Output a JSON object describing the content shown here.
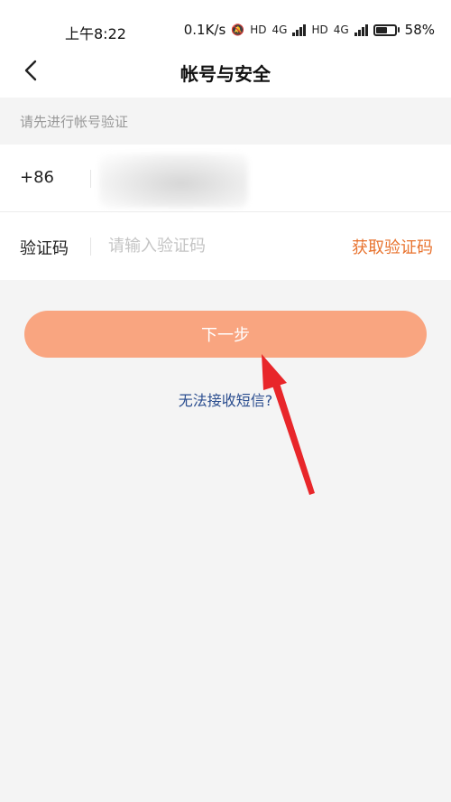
{
  "status_bar": {
    "time": "上午8:22",
    "network_speed": "0.1K/s",
    "network_1": "4G",
    "network_2": "4G",
    "battery": "58%",
    "battery_level": 0.58
  },
  "nav": {
    "title": "帐号与安全",
    "back_icon": "chevron-left-icon"
  },
  "section_hint": "请先进行帐号验证",
  "form": {
    "phone_label": "+86",
    "code_label": "验证码",
    "code_placeholder": "请输入验证码",
    "get_code_label": "获取验证码"
  },
  "next_button": "下一步",
  "no_sms_link": "无法接收短信?",
  "colors": {
    "accent": "#f9a580",
    "link_orange": "#e8732f",
    "link_blue": "#2a4d8f",
    "annotation_arrow": "#e8262a"
  }
}
